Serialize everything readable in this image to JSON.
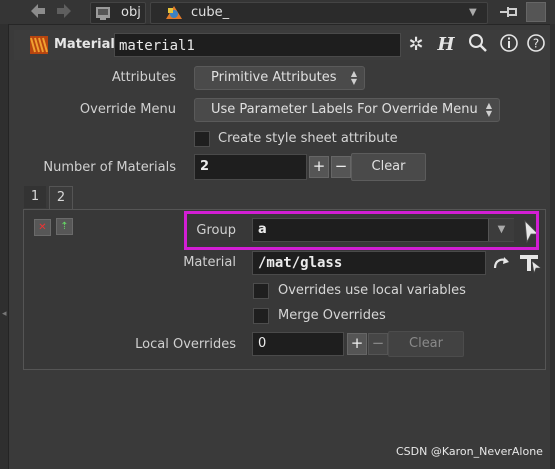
{
  "breadcrumb": {
    "network": "obj",
    "node": "cube_"
  },
  "header": {
    "type_label": "Material",
    "node_name": "material1"
  },
  "params": {
    "attributes": {
      "label": "Attributes",
      "value": "Primitive Attributes"
    },
    "override_menu": {
      "label": "Override Menu",
      "value": "Use Parameter Labels For Override Menu"
    },
    "style_sheet": {
      "label": "Create style sheet attribute",
      "checked": false
    },
    "num_materials": {
      "label": "Number of Materials",
      "value": "2",
      "plus": "+",
      "minus": "−",
      "clear": "Clear"
    }
  },
  "tabs": [
    "1",
    "2"
  ],
  "multiparm": {
    "group": {
      "label": "Group",
      "value": "a"
    },
    "material": {
      "label": "Material",
      "value": "/mat/glass"
    },
    "overrides_local": {
      "label": "Overrides use local variables",
      "checked": false
    },
    "merge_overrides": {
      "label": "Merge Overrides",
      "checked": false
    },
    "local_overrides": {
      "label": "Local Overrides",
      "value": "0",
      "plus": "+",
      "minus": "−",
      "clear": "Clear"
    }
  },
  "watermark": "CSDN @Karon_NeverAlone",
  "colors": {
    "highlight": "#d21ed4",
    "background": "#3a3a3a",
    "field": "#1e1e1e"
  },
  "icons": [
    "back-arrow-icon",
    "forward-arrow-icon",
    "network-icon",
    "node-icon",
    "pin-icon",
    "material-node-icon",
    "gear-icon",
    "help-h-icon",
    "search-icon",
    "info-icon",
    "question-icon",
    "remove-icon",
    "insert-icon",
    "select-arrow-icon",
    "link-arrow-icon",
    "node-chooser-icon"
  ]
}
